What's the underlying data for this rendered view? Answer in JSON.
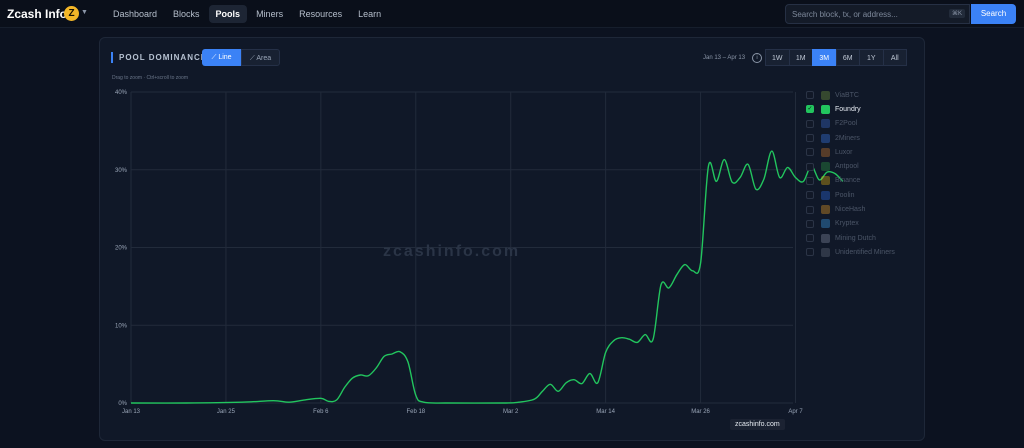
{
  "app": {
    "title": "Zcash Info",
    "logo_letter": "Z",
    "nav": [
      "Dashboard",
      "Blocks",
      "Pools",
      "Miners",
      "Resources",
      "Learn"
    ],
    "active_nav": "Pools",
    "search_placeholder": "Search block, tx, or address...",
    "search_shortcut": "⌘K",
    "search_button": "Search"
  },
  "panel": {
    "title": "POOL DOMINANCE",
    "toggle_line": "Line",
    "toggle_area": "Area",
    "hint": "Drag to zoom · Ctrl+scroll to zoom",
    "date_range": "Jan 13 – Apr 13",
    "ranges": [
      "1W",
      "1M",
      "3M",
      "6M",
      "1Y",
      "All"
    ],
    "active_range": "3M",
    "watermark": "zcashinfo.com",
    "badge": "zcashinfo.com"
  },
  "legend": [
    {
      "name": "ViaBTC",
      "checked": false,
      "icon": "viabtc-icon",
      "color": "#7aa23c"
    },
    {
      "name": "Foundry",
      "checked": true,
      "icon": "foundry-icon",
      "color": "#22c55e"
    },
    {
      "name": "F2Pool",
      "checked": false,
      "icon": "f2pool-icon",
      "color": "#3b6fd8"
    },
    {
      "name": "2Miners",
      "checked": false,
      "icon": "2miners-icon",
      "color": "#3b82f6"
    },
    {
      "name": "Luxor",
      "checked": false,
      "icon": "luxor-icon",
      "color": "#d9822b"
    },
    {
      "name": "Antpool",
      "checked": false,
      "icon": "antpool-icon",
      "color": "#2ea043"
    },
    {
      "name": "Binance",
      "checked": false,
      "icon": "binance-icon",
      "color": "#f0b90b"
    },
    {
      "name": "Poolin",
      "checked": false,
      "icon": "poolin-icon",
      "color": "#2f6feb"
    },
    {
      "name": "NiceHash",
      "checked": false,
      "icon": "nicehash-icon",
      "color": "#f5a623"
    },
    {
      "name": "Kryptex",
      "checked": false,
      "icon": "kryptex-icon",
      "color": "#3fa9f5"
    },
    {
      "name": "Mining Dutch",
      "checked": false,
      "icon": "miningdutch-icon",
      "color": "#8b96a8"
    },
    {
      "name": "Unidentified Miners",
      "checked": false,
      "icon": "unidentified-icon",
      "color": "#6b7280"
    }
  ],
  "chart_data": {
    "type": "line",
    "title": "POOL DOMINANCE",
    "xlabel": "",
    "ylabel": "",
    "ylim": [
      0,
      40
    ],
    "y_ticks": [
      "0%",
      "10%",
      "20%",
      "30%",
      "40%"
    ],
    "x_ticks": [
      "Jan 13",
      "Jan 25",
      "Feb 6",
      "Feb 18",
      "Mar 2",
      "Mar 14",
      "Mar 26",
      "Apr 7"
    ],
    "grid": true,
    "series": [
      {
        "name": "Foundry",
        "color": "#22c55e",
        "points": [
          [
            "2025-01-13",
            0
          ],
          [
            "2025-01-20",
            0
          ],
          [
            "2025-01-27",
            0.1
          ],
          [
            "2025-01-31",
            0.3
          ],
          [
            "2025-02-02",
            0.1
          ],
          [
            "2025-02-04",
            0.4
          ],
          [
            "2025-02-06",
            0.6
          ],
          [
            "2025-02-07",
            0.2
          ],
          [
            "2025-02-08",
            0.4
          ],
          [
            "2025-02-09",
            2.0
          ],
          [
            "2025-02-10",
            3.2
          ],
          [
            "2025-02-11",
            3.6
          ],
          [
            "2025-02-12",
            3.5
          ],
          [
            "2025-02-13",
            4.5
          ],
          [
            "2025-02-14",
            6.0
          ],
          [
            "2025-02-15",
            6.3
          ],
          [
            "2025-02-16",
            6.6
          ],
          [
            "2025-02-17",
            5.3
          ],
          [
            "2025-02-18",
            1.0
          ],
          [
            "2025-02-19",
            0.1
          ],
          [
            "2025-02-22",
            0
          ],
          [
            "2025-03-01",
            0
          ],
          [
            "2025-03-03",
            0.1
          ],
          [
            "2025-03-05",
            0.5
          ],
          [
            "2025-03-06",
            1.5
          ],
          [
            "2025-03-07",
            2.4
          ],
          [
            "2025-03-08",
            1.5
          ],
          [
            "2025-03-09",
            2.6
          ],
          [
            "2025-03-10",
            3.0
          ],
          [
            "2025-03-11",
            2.5
          ],
          [
            "2025-03-12",
            3.8
          ],
          [
            "2025-03-13",
            2.6
          ],
          [
            "2025-03-14",
            6.5
          ],
          [
            "2025-03-15",
            8.0
          ],
          [
            "2025-03-16",
            8.4
          ],
          [
            "2025-03-17",
            8.2
          ],
          [
            "2025-03-18",
            7.8
          ],
          [
            "2025-03-19",
            8.8
          ],
          [
            "2025-03-20",
            8.2
          ],
          [
            "2025-03-21",
            15.2
          ],
          [
            "2025-03-22",
            14.8
          ],
          [
            "2025-03-23",
            16.5
          ],
          [
            "2025-03-24",
            17.8
          ],
          [
            "2025-03-25",
            17.0
          ],
          [
            "2025-03-26",
            18.0
          ],
          [
            "2025-03-27",
            30.5
          ],
          [
            "2025-03-28",
            28.5
          ],
          [
            "2025-03-29",
            31.3
          ],
          [
            "2025-03-30",
            28.4
          ],
          [
            "2025-03-31",
            29.0
          ],
          [
            "2025-04-01",
            30.7
          ],
          [
            "2025-04-02",
            27.5
          ],
          [
            "2025-04-03",
            28.8
          ],
          [
            "2025-04-04",
            32.4
          ],
          [
            "2025-04-05",
            29.0
          ],
          [
            "2025-04-06",
            30.3
          ],
          [
            "2025-04-07",
            29.0
          ],
          [
            "2025-04-08",
            28.5
          ],
          [
            "2025-04-09",
            30.5
          ],
          [
            "2025-04-10",
            28.7
          ],
          [
            "2025-04-11",
            29.7
          ],
          [
            "2025-04-12",
            29.5
          ],
          [
            "2025-04-13",
            28.5
          ]
        ]
      }
    ]
  }
}
